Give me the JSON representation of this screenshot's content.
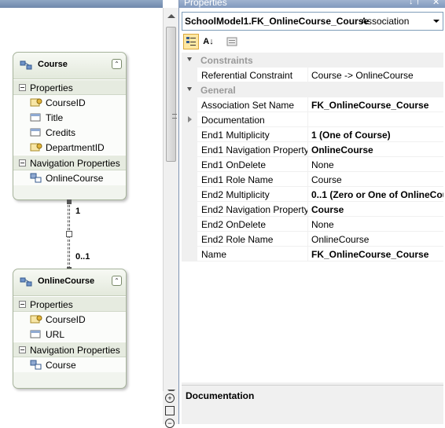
{
  "properties_window": {
    "title": "Properties",
    "pin_glyph": "↓ †",
    "close_glyph": "✕",
    "selector": {
      "object_name": "SchoolModel1.FK_OnlineCourse_Course",
      "object_type": "Association"
    },
    "toolbar": {
      "categorized_icon": "categorized-icon",
      "alphabetical_icon": "alphabetical-icon",
      "property_pages_icon": "property-pages-icon",
      "alphabetical_label": "A↓"
    },
    "categories": [
      {
        "label": "Constraints",
        "rows": [
          {
            "name": "Referential Constraint",
            "value": "Course -> OnlineCourse",
            "bold": false
          }
        ]
      },
      {
        "label": "General",
        "rows": [
          {
            "name": "Association Set Name",
            "value": "FK_OnlineCourse_Course",
            "bold": true
          },
          {
            "name": "Documentation",
            "value": "",
            "bold": false,
            "expandable": true
          },
          {
            "name": "End1 Multiplicity",
            "value": "1 (One of Course)",
            "bold": true
          },
          {
            "name": "End1 Navigation Property",
            "value": "OnlineCourse",
            "bold": true
          },
          {
            "name": "End1 OnDelete",
            "value": "None",
            "bold": false
          },
          {
            "name": "End1 Role Name",
            "value": "Course",
            "bold": false
          },
          {
            "name": "End2 Multiplicity",
            "value": "0..1 (Zero or One of OnlineCou",
            "bold": true
          },
          {
            "name": "End2 Navigation Property",
            "value": "Course",
            "bold": true
          },
          {
            "name": "End2 OnDelete",
            "value": "None",
            "bold": false
          },
          {
            "name": "End2 Role Name",
            "value": "OnlineCourse",
            "bold": false
          },
          {
            "name": "Name",
            "value": "FK_OnlineCourse_Course",
            "bold": true
          }
        ]
      }
    ],
    "description": {
      "title": "Documentation"
    }
  },
  "designer": {
    "entities": [
      {
        "name": "Course",
        "properties_label": "Properties",
        "properties": [
          {
            "label": "CourseID",
            "icon": "key-property-icon"
          },
          {
            "label": "Title",
            "icon": "property-icon"
          },
          {
            "label": "Credits",
            "icon": "property-icon"
          },
          {
            "label": "DepartmentID",
            "icon": "key-property-icon"
          }
        ],
        "nav_label": "Navigation Properties",
        "nav_properties": [
          {
            "label": "OnlineCourse",
            "icon": "navigation-property-icon"
          }
        ]
      },
      {
        "name": "OnlineCourse",
        "properties_label": "Properties",
        "properties": [
          {
            "label": "CourseID",
            "icon": "key-property-icon"
          },
          {
            "label": "URL",
            "icon": "property-icon"
          }
        ],
        "nav_label": "Navigation Properties",
        "nav_properties": [
          {
            "label": "Course",
            "icon": "navigation-property-icon"
          }
        ]
      }
    ],
    "association": {
      "end1_multiplicity": "1",
      "end2_multiplicity": "0..1"
    },
    "collapse_glyph": "⌃"
  },
  "colors": {
    "title_bar": "#8199bd",
    "category_bg": "#f0f0f0",
    "category_text": "#999999",
    "entity_bg": "#f1f4ee"
  }
}
